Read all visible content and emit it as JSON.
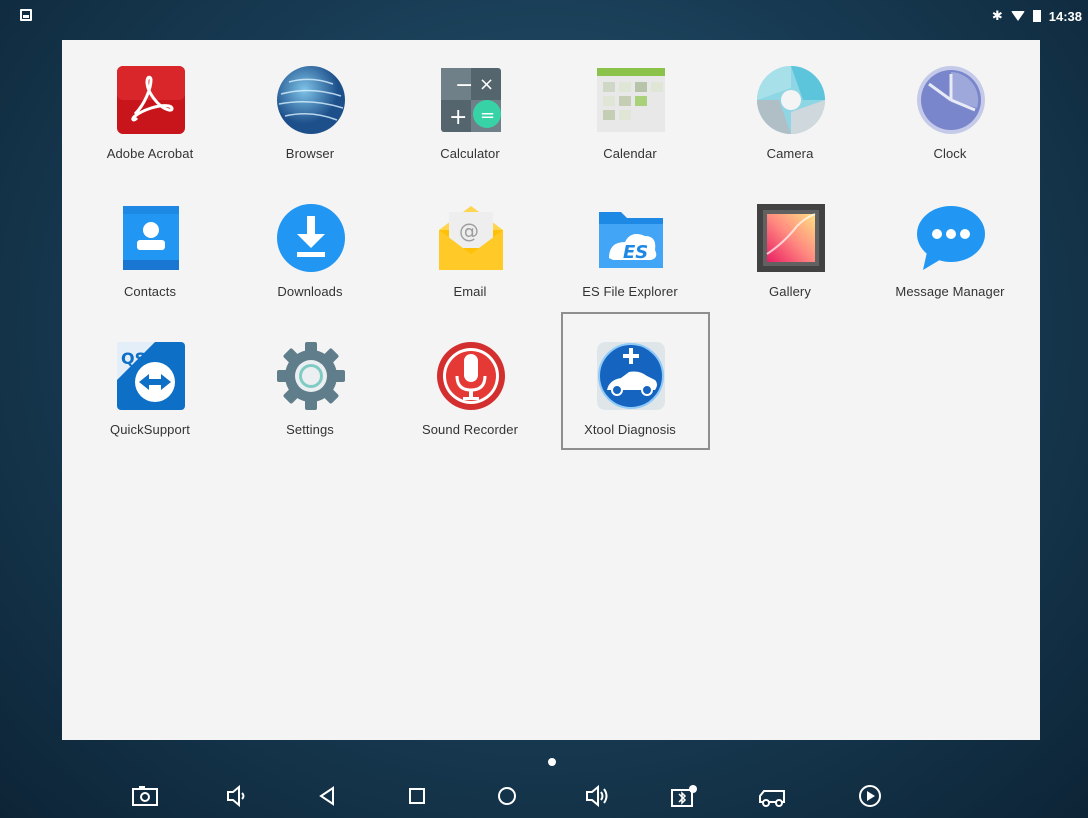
{
  "status_bar": {
    "time": "14:38",
    "icons": [
      "screenshot-notification-icon",
      "bluetooth-icon",
      "wifi-icon",
      "battery-icon"
    ]
  },
  "apps": [
    {
      "label": "Adobe Acrobat",
      "icon": "adobe-acrobat-icon"
    },
    {
      "label": "Browser",
      "icon": "browser-globe-icon"
    },
    {
      "label": "Calculator",
      "icon": "calculator-icon"
    },
    {
      "label": "Calendar",
      "icon": "calendar-icon"
    },
    {
      "label": "Camera",
      "icon": "camera-icon"
    },
    {
      "label": "Clock",
      "icon": "clock-icon"
    },
    {
      "label": "Contacts",
      "icon": "contacts-icon"
    },
    {
      "label": "Downloads",
      "icon": "download-icon"
    },
    {
      "label": "Email",
      "icon": "email-icon"
    },
    {
      "label": "ES File Explorer",
      "icon": "es-file-explorer-icon"
    },
    {
      "label": "Gallery",
      "icon": "gallery-icon"
    },
    {
      "label": "Message Manager",
      "icon": "message-bubble-icon"
    },
    {
      "label": "QuickSupport",
      "icon": "quicksupport-icon"
    },
    {
      "label": "Settings",
      "icon": "settings-gear-icon"
    },
    {
      "label": "Sound Recorder",
      "icon": "microphone-icon"
    },
    {
      "label": "Xtool Diagnosis",
      "icon": "xtool-car-icon",
      "highlighted": true
    }
  ],
  "nav_bar": {
    "buttons": [
      "screenshot-icon",
      "volume-down-icon",
      "back-icon",
      "recents-icon",
      "home-icon",
      "volume-up-icon",
      "bluetooth-settings-icon",
      "vehicle-icon",
      "play-icon"
    ]
  },
  "colors": {
    "drawer_bg": "#f4f4f4",
    "highlight_border": "#8e8e8e"
  }
}
